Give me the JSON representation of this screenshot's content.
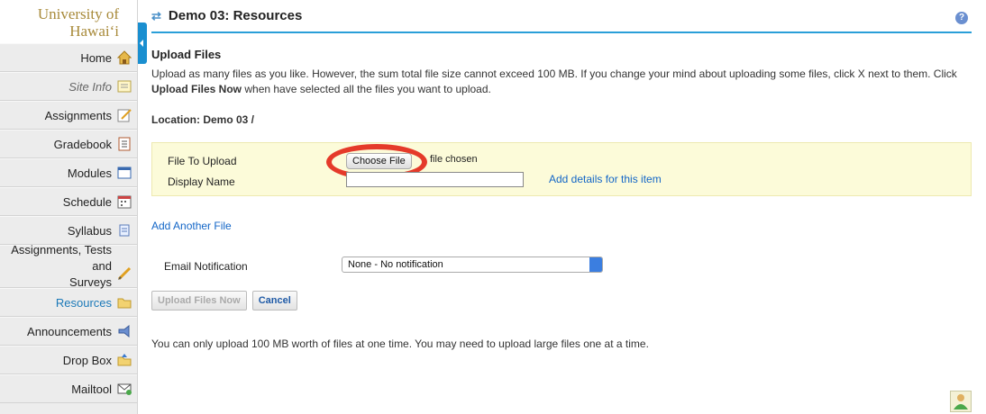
{
  "sidebar": {
    "logo_line1": "University of",
    "logo_line2": "Hawai‘i",
    "items": [
      {
        "label": "Home",
        "icon": "home-icon"
      },
      {
        "label": "Site Info",
        "icon": "site-info-icon"
      },
      {
        "label": "Assignments",
        "icon": "assignments-icon"
      },
      {
        "label": "Gradebook",
        "icon": "gradebook-icon"
      },
      {
        "label": "Modules",
        "icon": "modules-icon"
      },
      {
        "label": "Schedule",
        "icon": "schedule-icon"
      },
      {
        "label": "Syllabus",
        "icon": "syllabus-icon"
      },
      {
        "label_line1": "Assignments, Tests and",
        "label_line2": "Surveys",
        "icon": "pencil-icon"
      },
      {
        "label": "Resources",
        "icon": "folder-icon"
      },
      {
        "label": "Announcements",
        "icon": "announcements-icon"
      },
      {
        "label": "Drop Box",
        "icon": "dropbox-icon"
      },
      {
        "label": "Mailtool",
        "icon": "mail-icon"
      }
    ]
  },
  "header": {
    "title": "Demo 03: Resources",
    "help": "?"
  },
  "main": {
    "section_title": "Upload Files",
    "instructions_1": "Upload as many files as you like. However, the sum total file size cannot exceed 100 MB. If you change your mind about uploading some files, click X next to them. Click ",
    "instructions_bold": "Upload Files Now",
    "instructions_2": " when have selected all the files you want to upload.",
    "location": "Location: Demo 03 /",
    "file_to_upload_label": "File To Upload",
    "choose_file_label": "Choose File",
    "no_file_text": "file chosen",
    "display_name_label": "Display Name",
    "display_name_value": "",
    "details_link": "Add details for this item",
    "add_another": "Add Another File",
    "email_label": "Email Notification",
    "email_value": "None - No notification",
    "upload_btn": "Upload Files Now",
    "cancel_btn": "Cancel",
    "footnote": "You can only upload 100 MB worth of files at one time. You may need to upload large files one at a time."
  },
  "colors": {
    "accent": "#2a9fd8",
    "highlight_circle": "#e53a2a",
    "upload_box_bg": "#fcfbd9",
    "link": "#1366c7"
  }
}
